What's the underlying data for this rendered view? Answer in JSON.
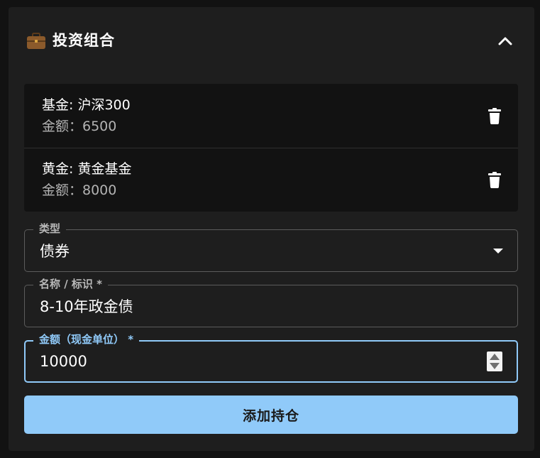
{
  "header": {
    "icon": "briefcase-icon",
    "title": "投资组合",
    "toggle_icon": "chevron-up-icon"
  },
  "holdings": [
    {
      "title": "基金: 沪深300",
      "amount_line": "金额：6500"
    },
    {
      "title": "黄金: 黄金基金",
      "amount_line": "金额：8000"
    }
  ],
  "form": {
    "type_field": {
      "label": "类型",
      "value": "债券"
    },
    "name_field": {
      "label": "名称 / 标识 *",
      "value": "8-10年政金债"
    },
    "amount_field": {
      "label": "金额（现金单位） *",
      "value": "10000"
    },
    "submit_label": "添加持仓"
  },
  "colors": {
    "accent": "#90caf9",
    "panel_bg": "#1e1e1e",
    "page_bg": "#121212"
  }
}
